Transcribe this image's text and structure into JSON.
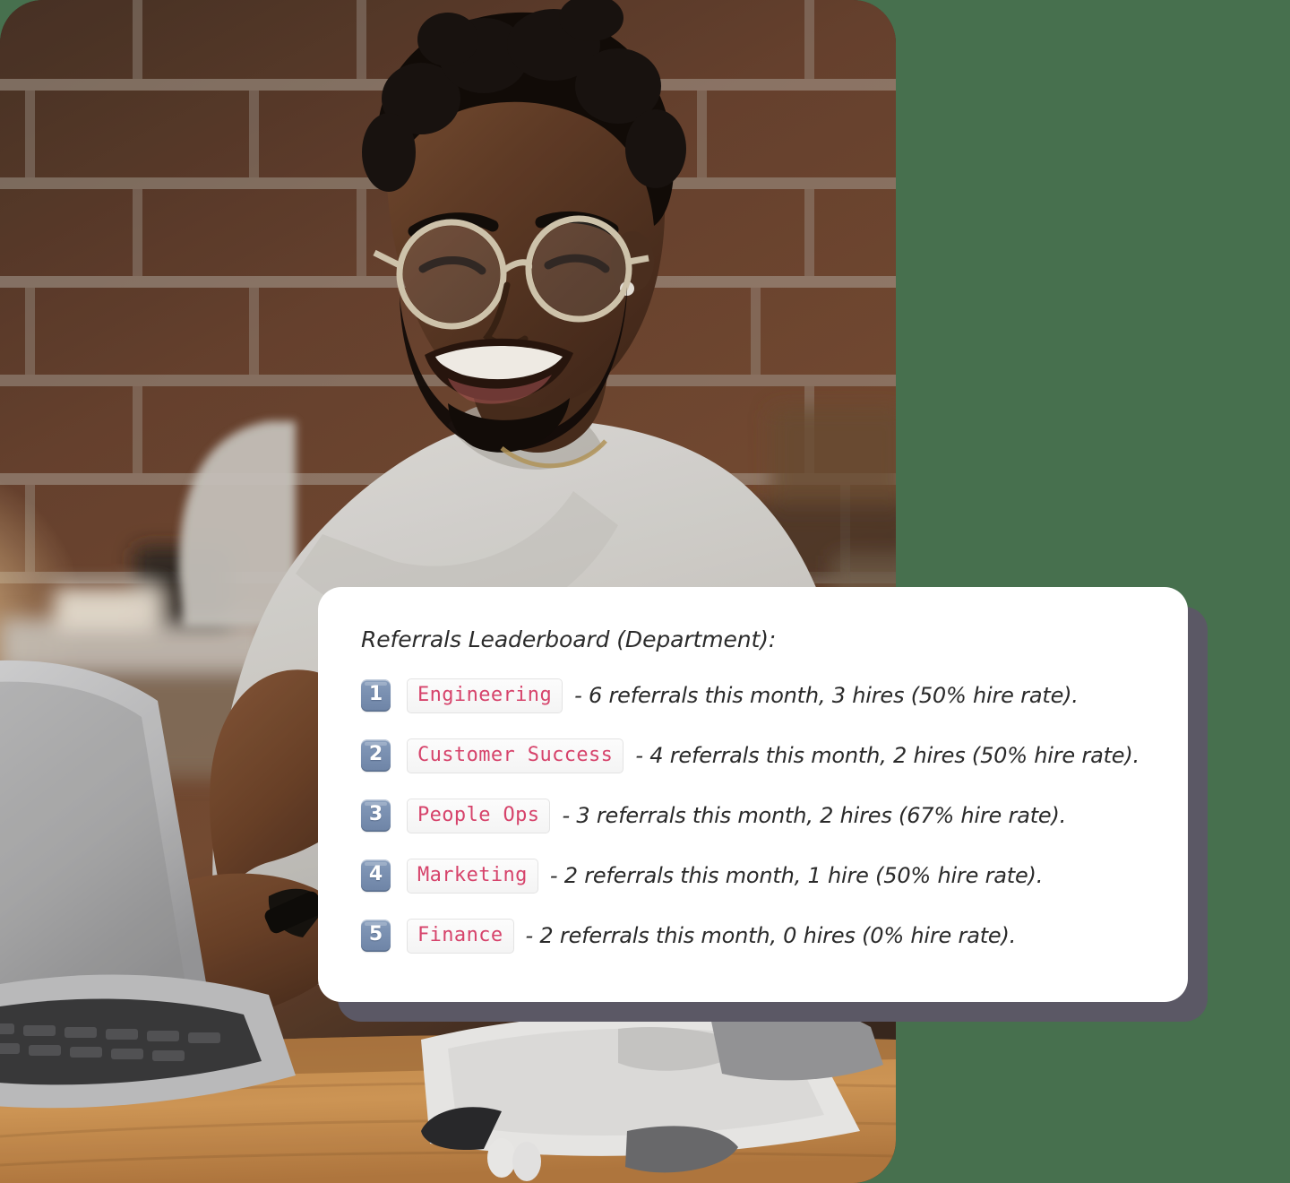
{
  "theme": {
    "background_color": "#47704E",
    "card_background": "#FFFFFF",
    "card_shadow_color": "#5B5865",
    "chip_text_color": "#D6436B",
    "badge_color": "#7A90B1",
    "body_text_color": "#2A2A2A"
  },
  "photo": {
    "alt": "Smiling man with glasses and a beard typing on a laptop at a wooden desk in front of an exposed brick wall",
    "scene": "office-workspace-photo"
  },
  "card": {
    "title": "Referrals Leaderboard (Department):",
    "rows": [
      {
        "rank": "1",
        "department": "Engineering",
        "description": "- 6 referrals this month, 3 hires (50% hire rate)."
      },
      {
        "rank": "2",
        "department": "Customer Success",
        "description": "- 4 referrals this month, 2 hires (50% hire rate)."
      },
      {
        "rank": "3",
        "department": "People Ops",
        "description": "- 3 referrals this month, 2 hires (67% hire rate)."
      },
      {
        "rank": "4",
        "department": "Marketing",
        "description": "- 2 referrals this month, 1 hire (50% hire rate)."
      },
      {
        "rank": "5",
        "department": "Finance",
        "description": "- 2 referrals this month, 0 hires (0% hire rate)."
      }
    ]
  }
}
